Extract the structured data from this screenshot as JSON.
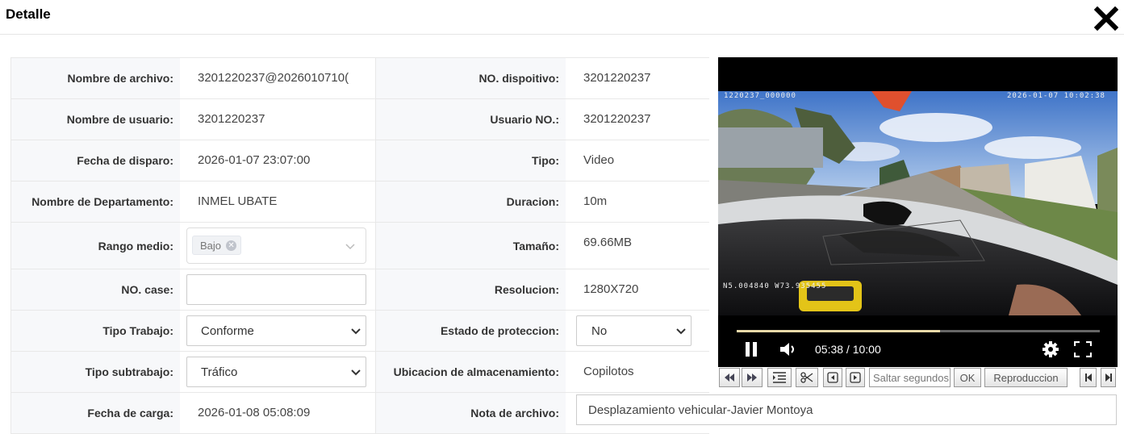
{
  "dialog": {
    "title": "Detalle",
    "close_icon": "close-x-icon"
  },
  "fields": {
    "file_name": {
      "label": "Nombre de archivo:",
      "value": "3201220237@2026010710("
    },
    "device_no": {
      "label": "NO. dispoitivo:",
      "value": "3201220237"
    },
    "user_name": {
      "label": "Nombre de usuario:",
      "value": "3201220237"
    },
    "user_no": {
      "label": "Usuario NO.:",
      "value": "3201220237"
    },
    "trigger_date": {
      "label": "Fecha de disparo:",
      "value": "2026-01-07 23:07:00"
    },
    "type": {
      "label": "Tipo:",
      "value": "Video"
    },
    "department": {
      "label": "Nombre de Departamento:",
      "value": "INMEL UBATE"
    },
    "duration": {
      "label": "Duracion:",
      "value": "10m"
    },
    "medium_range": {
      "label": "Rango medio:",
      "tag": "Bajo"
    },
    "size": {
      "label": "Tamaño:",
      "value": "69.66MB"
    },
    "case_no": {
      "label": "NO. case:",
      "value": ""
    },
    "resolution": {
      "label": "Resolucion:",
      "value": "1280X720"
    },
    "work_type": {
      "label": "Tipo Trabajo:",
      "value": "Conforme"
    },
    "protection_state": {
      "label": "Estado de proteccion:",
      "value": "No"
    },
    "work_subtype": {
      "label": "Tipo subtrabajo:",
      "value": "Tráfico"
    },
    "storage_location": {
      "label": "Ubicacion de almacenamiento:",
      "value": "Copilotos"
    },
    "upload_date": {
      "label": "Fecha de carga:",
      "value": "2026-01-08 05:08:09"
    },
    "file_note": {
      "label": "Nota de archivo:",
      "value": "Desplazamiento vehicular-Javier Montoya"
    }
  },
  "video": {
    "osd_top_left": "1220237_000000",
    "osd_top_right": "2026-01-07  10:02:38",
    "osd_gps": "N5.004840  W73.935455",
    "time_display": "05:38 / 10:00",
    "progress_fraction": 0.56
  },
  "toolbar": {
    "seek_placeholder": "Saltar segundos",
    "ok_label": "OK",
    "playback_label": "Reproduccion"
  },
  "colors": {
    "label_bg": "#f7f8fa",
    "border": "#e8e8e8",
    "progress": "#e8d9a8"
  }
}
